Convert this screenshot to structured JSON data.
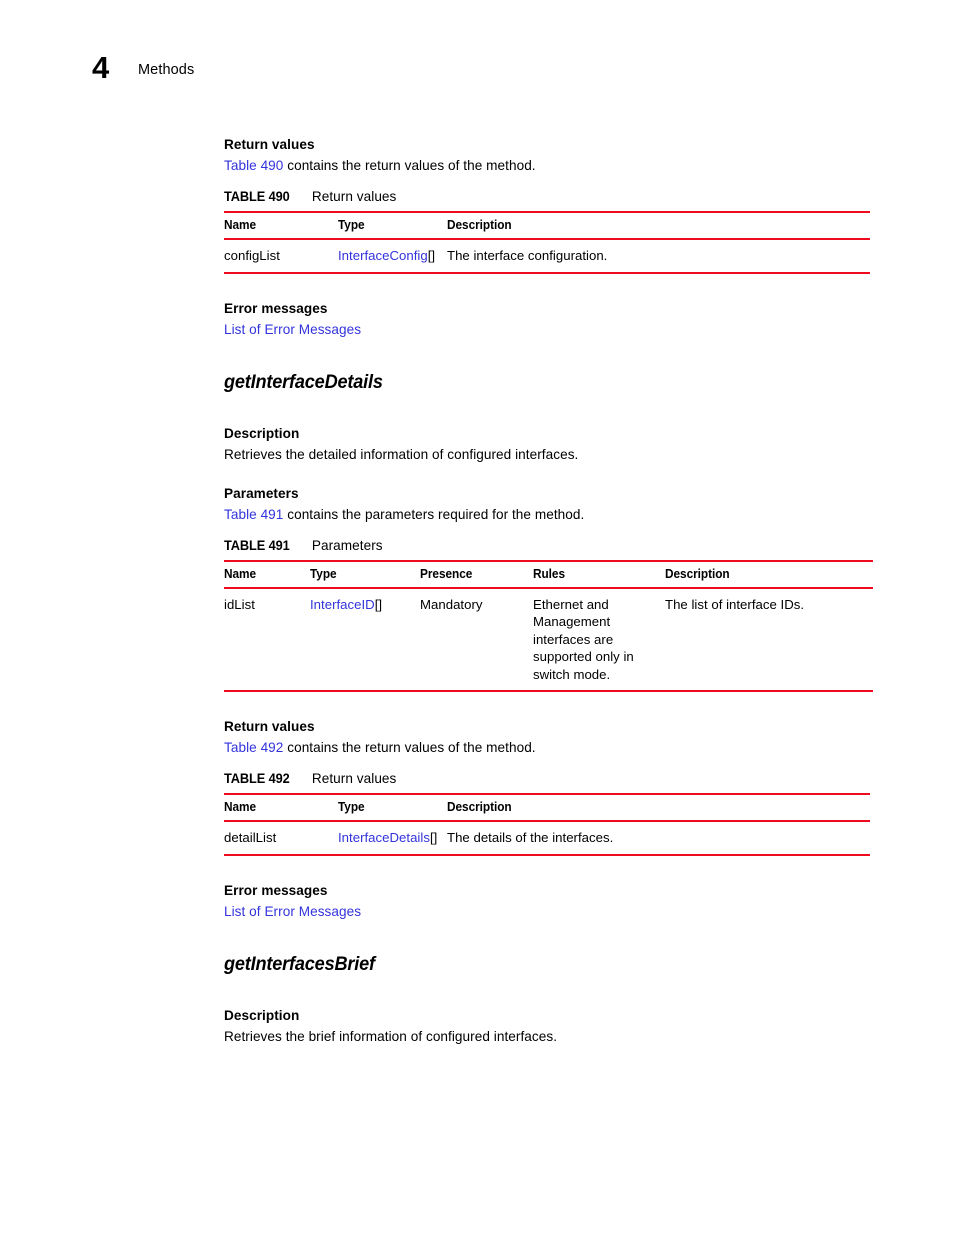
{
  "page": {
    "chapter_number": "4",
    "chapter_title": "Methods"
  },
  "colors": {
    "rule_red": "#ee0b1e",
    "link_blue": "#3333dd",
    "text_black": "#000000"
  },
  "sections": {
    "first_return_values": {
      "label": "Return values",
      "intro_link": "Table 490",
      "intro_rest": " contains the return values of the method."
    },
    "first_error_messages": {
      "label": "Error messages",
      "link": "List of Error Messages"
    },
    "get_interface_details": {
      "heading": "getInterfaceDetails",
      "description_label": "Description",
      "description_text": "Retrieves the detailed information of configured interfaces.",
      "parameters_label": "Parameters",
      "parameters_intro_link": "Table 491",
      "parameters_intro_rest": " contains the parameters required for the method.",
      "return_values_label": "Return values",
      "return_intro_link": "Table 492",
      "return_intro_rest": " contains the return values of the method.",
      "error_messages_label": "Error messages",
      "error_messages_link": "List of Error Messages"
    },
    "get_interfaces_brief": {
      "heading": "getInterfacesBrief",
      "description_label": "Description",
      "description_text": "Retrieves the brief information of configured interfaces."
    }
  },
  "tables": {
    "t490": {
      "caption_number": "TABLE 490",
      "caption_text": "Return values",
      "headers": [
        "Name",
        "Type",
        "Description"
      ],
      "rows": [
        {
          "name": "configList",
          "type_link": "InterfaceConfig",
          "type_suffix": "[]",
          "description": "The interface configuration."
        }
      ]
    },
    "t491": {
      "caption_number": "TABLE 491",
      "caption_text": "Parameters",
      "headers": [
        "Name",
        "Type",
        "Presence",
        "Rules",
        "Description"
      ],
      "rows": [
        {
          "name": "idList",
          "type_link": "InterfaceID",
          "type_suffix": "[]",
          "presence": "Mandatory",
          "rules": "Ethernet and Management interfaces are supported only in switch mode.",
          "description": "The list of interface IDs."
        }
      ]
    },
    "t492": {
      "caption_number": "TABLE 492",
      "caption_text": "Return values",
      "headers": [
        "Name",
        "Type",
        "Description"
      ],
      "rows": [
        {
          "name": "detailList",
          "type_link": "InterfaceDetails",
          "type_suffix": "[]",
          "description": "The details of the interfaces."
        }
      ]
    }
  }
}
